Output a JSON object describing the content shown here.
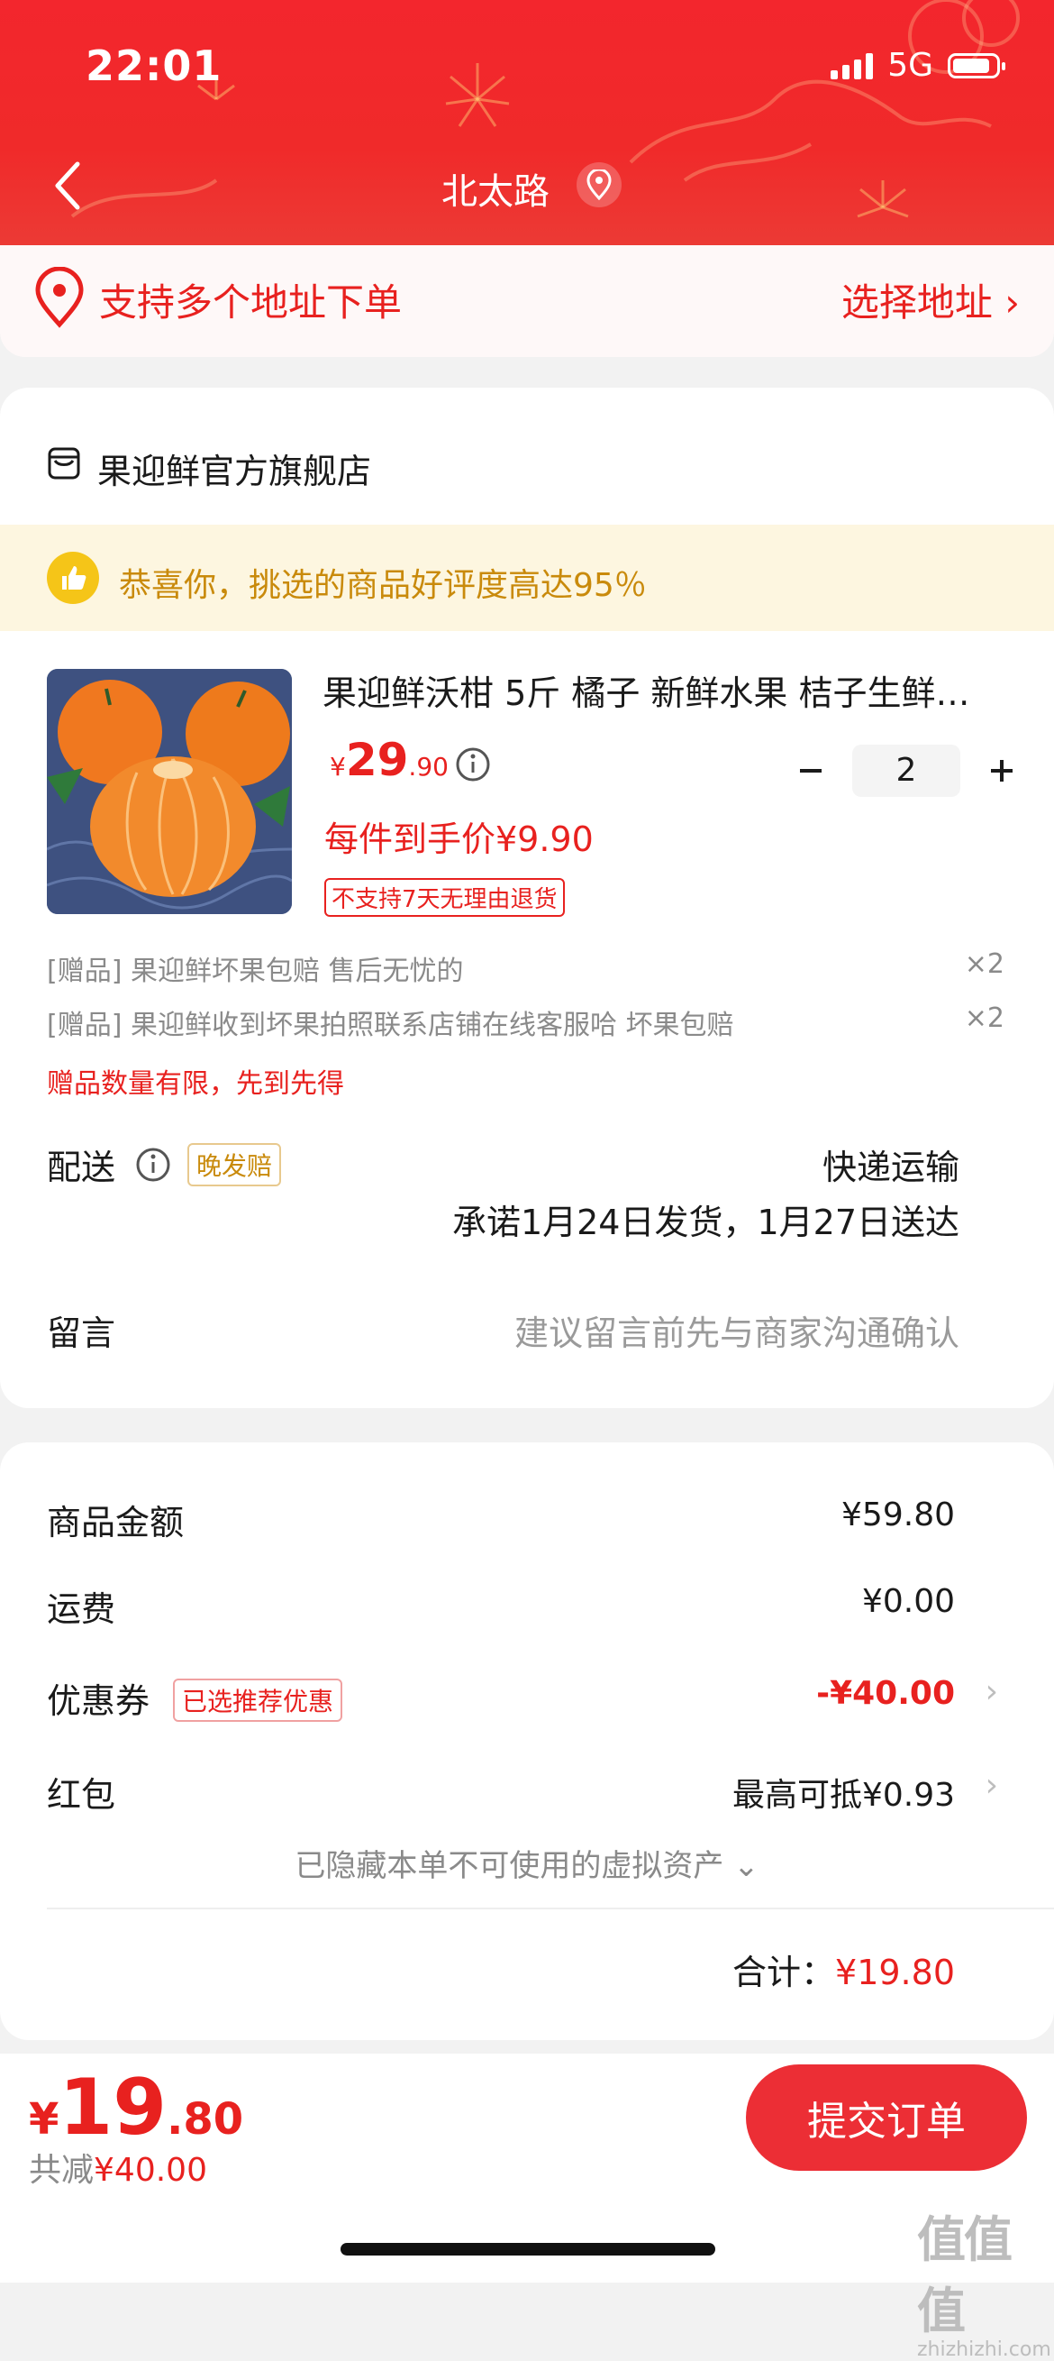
{
  "status_bar": {
    "time": "22:01",
    "network": "5G"
  },
  "header": {
    "title": "北太路"
  },
  "address_bar": {
    "text": "支持多个地址下单",
    "action": "选择地址 ›"
  },
  "store": {
    "name": "果迎鲜官方旗舰店",
    "praise": "恭喜你，挑选的商品好评度高达95％"
  },
  "product": {
    "title": "果迎鲜沃柑 5斤 橘子 新鲜水果 桔子生鲜…",
    "price_symbol": "¥",
    "price_int": "29",
    "price_dec": ".90",
    "quantity": "2",
    "per_price": "每件到手价¥9.90",
    "return_tag": "不支持7天无理由退货"
  },
  "gifts": [
    {
      "text": "[赠品] 果迎鲜坏果包赔 售后无忧的",
      "qty": "×2"
    },
    {
      "text": "[赠品] 果迎鲜收到坏果拍照联系店铺在线客服哈 坏果包赔",
      "qty": "×2"
    }
  ],
  "gift_note": "赠品数量有限，先到先得",
  "delivery": {
    "label": "配送",
    "tag": "晚发赔",
    "method": "快递运输",
    "promise": "承诺1月24日发货，1月27日送达"
  },
  "message": {
    "label": "留言",
    "placeholder": "建议留言前先与商家沟通确认"
  },
  "fees": {
    "goods_label": "商品金额",
    "goods_value": "¥59.80",
    "shipping_label": "运费",
    "shipping_value": "¥0.00",
    "coupon_label": "优惠券",
    "coupon_tag": "已选推荐优惠",
    "coupon_value": "-¥40.00",
    "redpacket_label": "红包",
    "redpacket_value": "最高可抵¥0.93",
    "hidden_assets": "已隐藏本单不可使用的虚拟资产 ⌄",
    "total_label": "合计：",
    "total_value": "¥19.80"
  },
  "bottom": {
    "price_symbol": "¥",
    "price_int": "19",
    "price_dec": ".80",
    "saved_label": "共减",
    "saved_value": "¥40.00",
    "submit_label": "提交订单"
  },
  "watermark": {
    "line1": "值值值",
    "line2": "zhizhizhi.com"
  },
  "colors": {
    "primary_red": "#e8211f",
    "header_red": "#f02a2a",
    "praise_gold": "#c98a0b"
  }
}
